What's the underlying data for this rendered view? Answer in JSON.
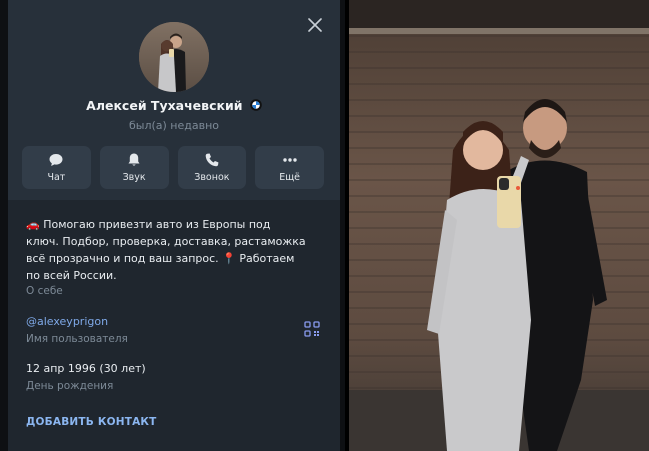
{
  "profile": {
    "name": "Алексей Тухачевский",
    "status": "был(а) недавно"
  },
  "actions": [
    {
      "label": "Чат",
      "icon": "chat-icon"
    },
    {
      "label": "Звук",
      "icon": "bell-icon"
    },
    {
      "label": "Звонок",
      "icon": "phone-icon"
    },
    {
      "label": "Ещё",
      "icon": "more-icon"
    }
  ],
  "info": {
    "bio": "🚗 Помогаю привезти авто из Европы под ключ. Подбор, проверка, доставка, растаможка всё прозрачно и под ваш запрос. 📍 Работаем по всей России.",
    "bio_caption": "О себе",
    "username": "@alexeyprigon",
    "username_caption": "Имя пользователя",
    "birthday": "12 апр 1996 (30 лет)",
    "birthday_caption": "День рождения",
    "add_contact": "ДОБАВИТЬ КОНТАКТ"
  },
  "colors": {
    "panel_bg": "#1f262e",
    "header_bg": "#27303a",
    "button_bg": "#323d49",
    "link": "#7fa9e8",
    "muted_text": "#7d8a97"
  }
}
